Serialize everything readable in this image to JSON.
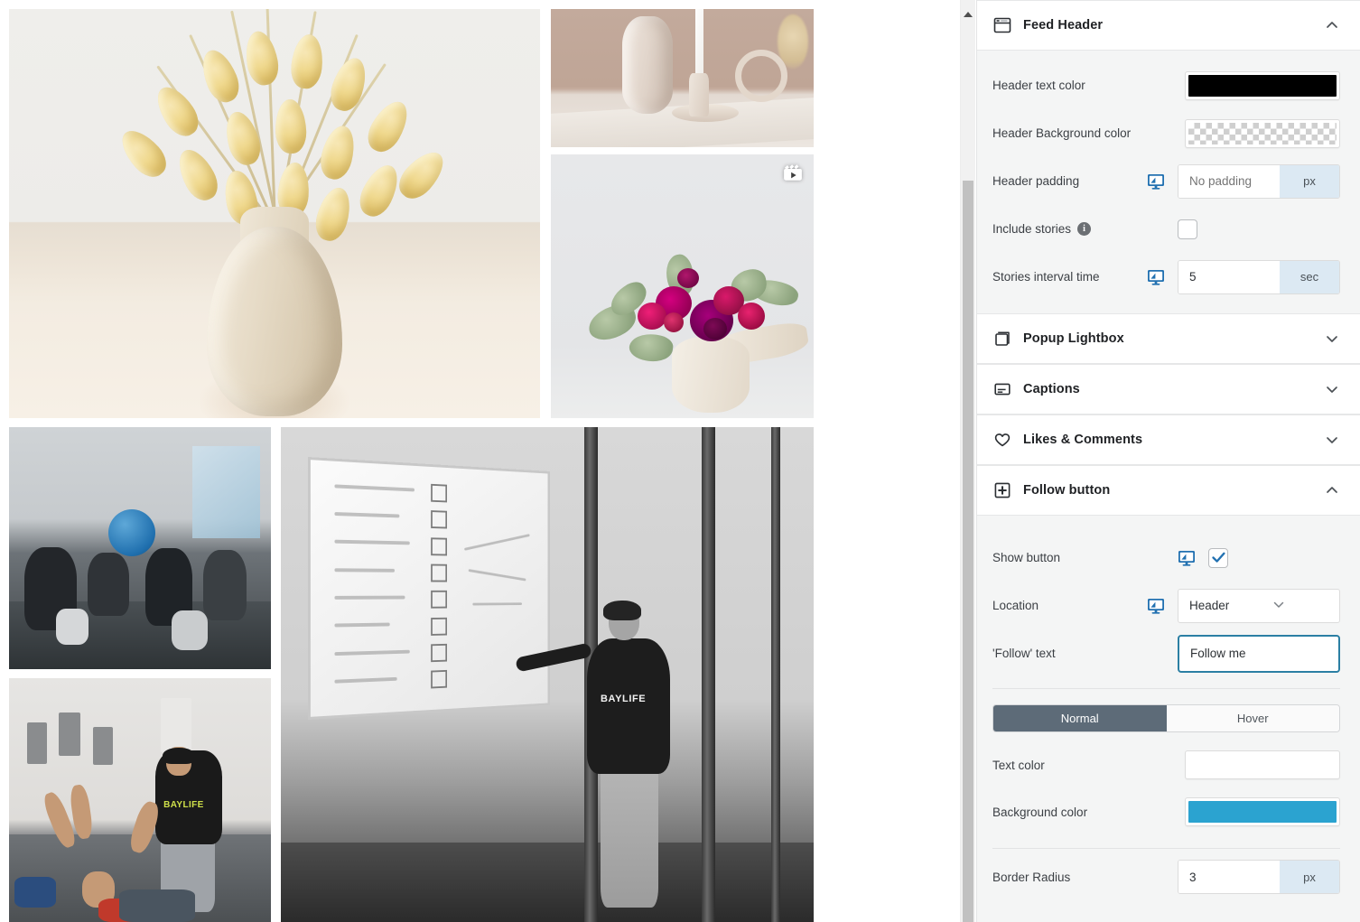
{
  "preview": {
    "name": "instagram-feed-preview",
    "tiles": [
      {
        "id": "tile-dried-grass-vase",
        "alt": "Dried bunny tail grass in cream ceramic vase",
        "badge": null
      },
      {
        "id": "tile-ceramic-candle",
        "alt": "Beige ceramic vase and white candle on pedestal",
        "badge": null
      },
      {
        "id": "tile-floral-arrangement",
        "alt": "Magenta and pink floral arrangement in white vase",
        "badge": "reels-icon"
      },
      {
        "id": "tile-gym-stretching",
        "alt": "Athletes stretching on gym floor",
        "badge": null
      },
      {
        "id": "tile-whiteboard-coach",
        "alt": "Coach pointing at whiteboard in gym, black and white",
        "badge": null
      },
      {
        "id": "tile-trainer-assist",
        "alt": "Trainer assisting person with stretch on gym mat",
        "badge": null
      }
    ],
    "shirt_text": "BAYLIFE",
    "tank_text": "BAYLIFE"
  },
  "scrollbar": {
    "up_arrow": "triangle-up-icon",
    "position_percent": 20
  },
  "panel": {
    "sections": [
      {
        "id": "feed-header",
        "title": "Feed Header",
        "icon": "window-icon",
        "expanded": true,
        "chevron": "chevron-up-icon",
        "rows": [
          {
            "id": "header-text-color",
            "label": "Header text color",
            "control": "color-swatch",
            "responsive_icon": false,
            "value": "#000000",
            "swatch_class": "black"
          },
          {
            "id": "header-background-color",
            "label": "Header Background color",
            "control": "color-swatch",
            "responsive_icon": false,
            "value": "transparent",
            "swatch_class": "transparent"
          },
          {
            "id": "header-padding",
            "label": "Header padding",
            "control": "unit-input",
            "responsive_icon": true,
            "value": "",
            "placeholder": "No padding",
            "unit": "px"
          },
          {
            "id": "include-stories",
            "label": "Include stories",
            "control": "checkbox",
            "responsive_icon": false,
            "info_icon": "info-icon",
            "checked": false
          },
          {
            "id": "stories-interval-time",
            "label": "Stories interval time",
            "control": "unit-input",
            "responsive_icon": true,
            "value": "5",
            "placeholder": "",
            "unit": "sec"
          }
        ]
      },
      {
        "id": "popup-lightbox",
        "title": "Popup Lightbox",
        "icon": "layers-square-icon",
        "expanded": false,
        "chevron": "chevron-down-icon",
        "rows": []
      },
      {
        "id": "captions",
        "title": "Captions",
        "icon": "caption-lines-icon",
        "expanded": false,
        "chevron": "chevron-down-icon",
        "rows": []
      },
      {
        "id": "likes-comments",
        "title": "Likes & Comments",
        "icon": "heart-icon",
        "expanded": false,
        "chevron": "chevron-down-icon",
        "rows": []
      },
      {
        "id": "follow-button",
        "title": "Follow button",
        "icon": "plus-square-icon",
        "expanded": true,
        "chevron": "chevron-up-icon",
        "rows": [
          {
            "id": "show-button",
            "label": "Show button",
            "control": "checkbox",
            "responsive_icon": true,
            "checked": true
          },
          {
            "id": "location",
            "label": "Location",
            "control": "select",
            "responsive_icon": true,
            "value": "Header",
            "chevron": "chevron-down-icon"
          },
          {
            "id": "follow-text",
            "label": "'Follow' text",
            "control": "text-input",
            "responsive_icon": false,
            "value": "Follow me",
            "focused": true
          }
        ],
        "state_tabs": {
          "id": "follow-button-state-tabs",
          "active": "Normal",
          "options": [
            "Normal",
            "Hover"
          ]
        },
        "state_rows": [
          {
            "id": "follow-text-color",
            "label": "Text color",
            "control": "color-swatch",
            "value": "#ffffff",
            "swatch_class": "white"
          },
          {
            "id": "follow-background-color",
            "label": "Background color",
            "control": "color-swatch",
            "value": "#2ba3d0",
            "swatch_class": "blue"
          }
        ],
        "radius_row": {
          "id": "border-radius",
          "label": "Border Radius",
          "control": "unit-input",
          "value": "3",
          "unit": "px"
        }
      }
    ]
  },
  "colors": {
    "accent_blue": "#2ba3d0",
    "focus_border": "#2b7fa3",
    "segment_active": "#5d6b78",
    "unit_suffix_bg": "#dce9f3",
    "panel_bg": "#f4f5f5",
    "responsive_icon": "#2271b1"
  }
}
